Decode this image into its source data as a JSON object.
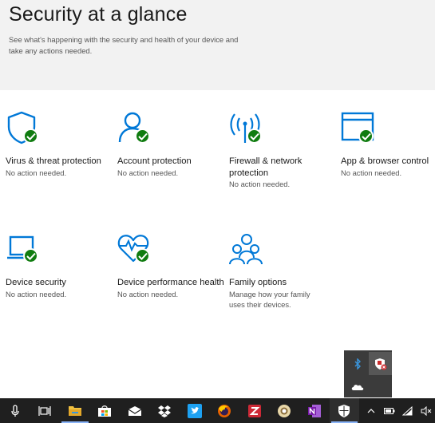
{
  "header": {
    "title": "Security at a glance",
    "subtitle": "See what's happening with the security and health of your device and take any actions needed."
  },
  "tiles": [
    {
      "title": "Virus & threat protection",
      "status": "No action needed.",
      "icon": "shield-icon"
    },
    {
      "title": "Account protection",
      "status": "No action needed.",
      "icon": "person-icon"
    },
    {
      "title": "Firewall & network protection",
      "status": "No action needed.",
      "icon": "antenna-icon"
    },
    {
      "title": "App & browser control",
      "status": "No action needed.",
      "icon": "browser-window-icon"
    },
    {
      "title": "Device security",
      "status": "No action needed.",
      "icon": "laptop-icon"
    },
    {
      "title": "Device performance health",
      "status": "No action needed.",
      "icon": "heart-pulse-icon"
    },
    {
      "title": "Family options",
      "status": "Manage how your family uses their devices.",
      "icon": "family-icon"
    }
  ],
  "colors": {
    "accent": "#0078d7",
    "ok_badge": "#107c10",
    "header_bg": "#f2f2f2",
    "taskbar_bg": "#1f1f1f"
  },
  "taskbar": {
    "apps": [
      "microphone-icon",
      "task-view-icon",
      "file-explorer-icon",
      "store-icon",
      "mail-icon",
      "dropbox-icon",
      "twitter-icon",
      "firefox-icon",
      "zotero-icon",
      "chrome-canary-icon",
      "onenote-icon",
      "windows-security-icon"
    ],
    "tray": [
      "chevron-up-icon",
      "battery-icon",
      "wifi-icon",
      "volume-muted-icon"
    ]
  },
  "tray_popup": {
    "items": [
      "bluetooth-icon",
      "security-alert-icon",
      "onedrive-icon"
    ]
  }
}
